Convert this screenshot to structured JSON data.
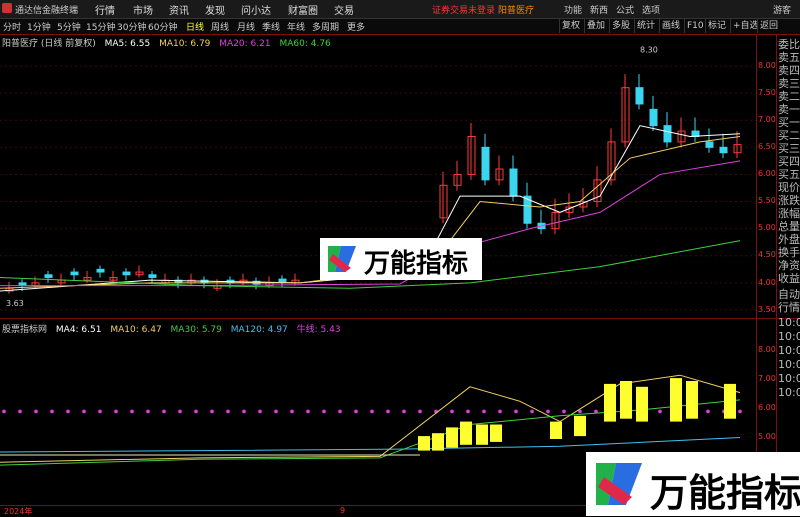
{
  "app": {
    "title": "通达信金融终端"
  },
  "menu": [
    "行情",
    "市场",
    "资讯",
    "发现",
    "问小达",
    "财富圈",
    "交易"
  ],
  "status": {
    "warning": "证券交易未登录",
    "stock_name": "阳普医疗"
  },
  "right_menu": [
    "功能",
    "新西",
    "公式",
    "选项"
  ],
  "guest": "游客",
  "period_tabs": [
    "分时",
    "1分钟",
    "5分钟",
    "15分钟",
    "30分钟",
    "60分钟",
    "日线",
    "周线",
    "月线",
    "季线",
    "年线",
    "多周期",
    "更多"
  ],
  "active_tab": "日线",
  "toolbar_buttons": [
    "复权",
    "叠加",
    "多股",
    "统计",
    "画线",
    "F10",
    "标记",
    "+自选",
    "返回"
  ],
  "upper_legend": {
    "title": "阳普医疗 (日线 前复权)",
    "ma5": "MA5: 6.55",
    "ma10": "MA10: 6.79",
    "ma20": "MA20: 6.21",
    "ma60": "MA60: 4.76"
  },
  "lower_legend": {
    "title": "股票指标网",
    "ma4": "MA4: 6.51",
    "ma10": "MA10: 6.47",
    "ma30": "MA30: 5.79",
    "ma120": "MA120: 4.97",
    "extra": "牛线: 5.43"
  },
  "upper_axis": [
    "8.00",
    "7.50",
    "7.00",
    "6.50",
    "6.00",
    "5.50",
    "5.00",
    "4.50",
    "4.00",
    "3.50"
  ],
  "lower_axis": [
    "8.00",
    "7.00",
    "6.00",
    "5.00"
  ],
  "high_label": "8.30",
  "low_label": "3.63",
  "right_panel": [
    "委比",
    "卖五",
    "卖四",
    "卖三",
    "卖二",
    "卖一",
    "买一",
    "买二",
    "买三",
    "买四",
    "买五",
    "现价",
    "涨跌",
    "涨幅",
    "总量",
    "外盘",
    "换手",
    "净资",
    "收益",
    "自动",
    "行情",
    "10:0",
    "10:0",
    "10:0",
    "10:0",
    "10:0",
    "10:0"
  ],
  "bottom": {
    "year": "2024年",
    "month": "9"
  },
  "watermark": "万能指标",
  "colors": {
    "up": "#ff3b3b",
    "down": "#3ad6f0",
    "ma5": "#ffffff",
    "ma10": "#f0d060",
    "ma20": "#e040e0",
    "ma60": "#40d040",
    "axis": "#7a1010"
  }
}
